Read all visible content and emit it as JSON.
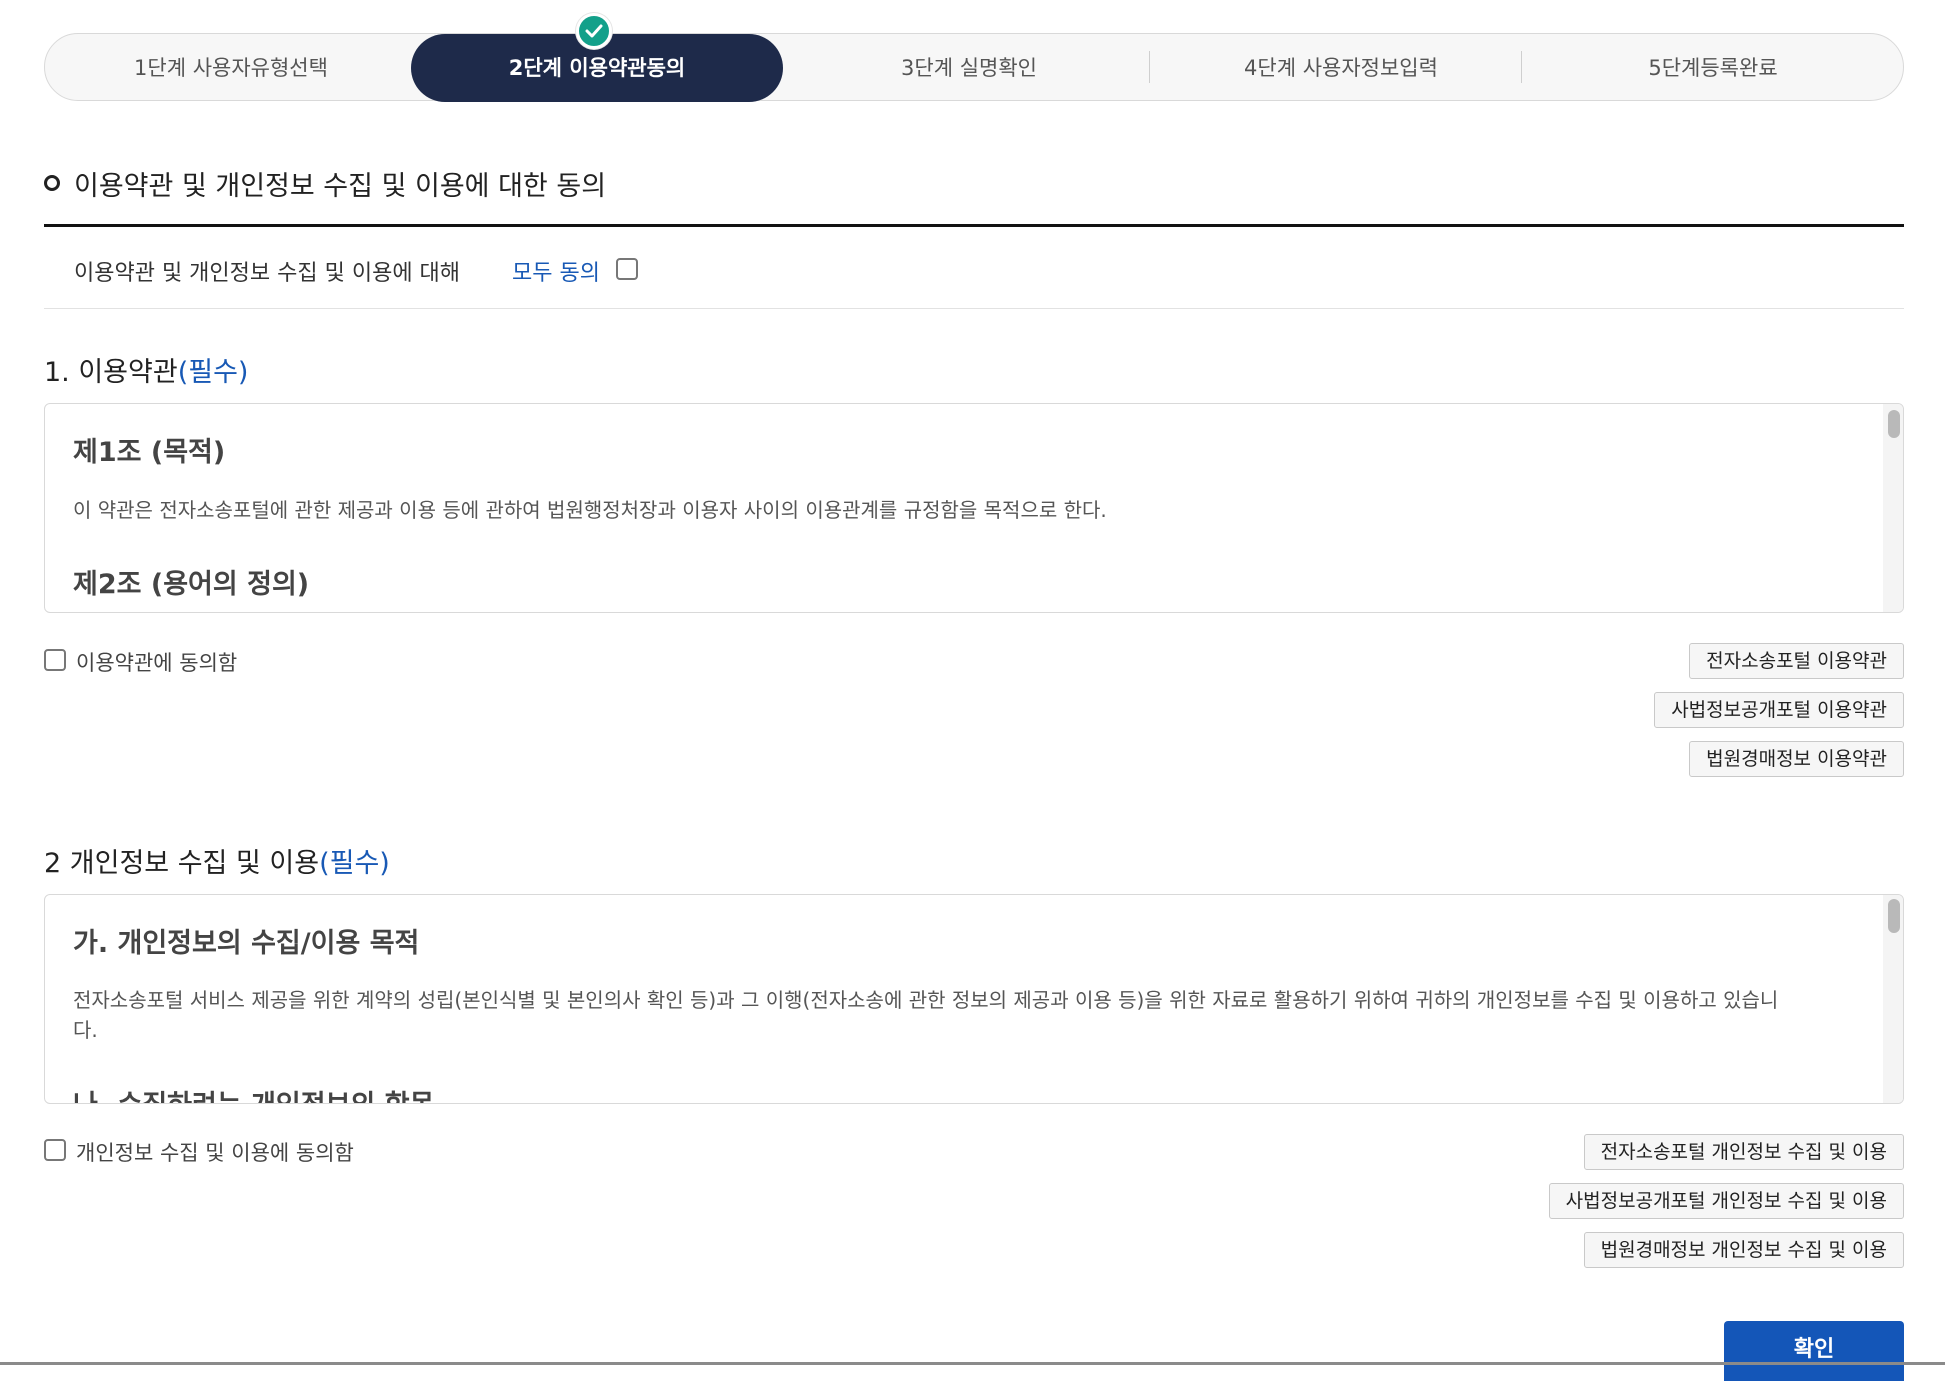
{
  "stepper": {
    "steps": [
      {
        "label": "1단계 사용자유형선택"
      },
      {
        "label": "2단계 이용약관동의"
      },
      {
        "label": "3단계 실명확인"
      },
      {
        "label": "4단계 사용자정보입력"
      },
      {
        "label": "5단계등록완료"
      }
    ],
    "active_index": 1,
    "active_color": "#1e2a4a",
    "check_color": "#13a08a"
  },
  "section": {
    "title": "이용약관 및 개인정보 수집 및 이용에 대한 동의",
    "agree_all_text": "이용약관 및 개인정보 수집 및 이용에 대해",
    "agree_all_link": "모두 동의"
  },
  "terms": {
    "title": "1. 이용약관",
    "required": "(필수)",
    "content": {
      "h1": "제1조 (목적)",
      "p1": "이 약관은 전자소송포털에 관한 제공과 이용 등에 관하여 법원행정처장과 이용자 사이의 이용관계를 규정함을 목적으로 한다.",
      "h2": "제2조 (용어의 정의)"
    },
    "agree_label": "이용약관에 동의함",
    "buttons": [
      "전자소송포털 이용약관",
      "사법정보공개포털 이용약관",
      "법원경매정보 이용약관"
    ]
  },
  "privacy": {
    "title": "2 개인정보 수집 및 이용",
    "required": "(필수)",
    "content": {
      "h1": "가. 개인정보의 수집/이용 목적",
      "p1a": "전자소송포털 서비스 제공을 위한 계약의 성립(본인식별 및 본인의사 확인 등)과 그 이행(전자소송에 관한 정보의 제공과 이용 등)을 위한 자료로 활용하기 위하여 귀하의 개인정보를 수집 및 이용하고 있습니",
      "p1b": "다.",
      "h2": "나. 수집하려는 개인정보의 항목"
    },
    "agree_label": "개인정보 수집 및 이용에 동의함",
    "buttons": [
      "전자소송포털 개인정보 수집 및 이용",
      "사법정보공개포털 개인정보 수집 및 이용",
      "법원경매정보 개인정보 수집 및 이용"
    ]
  },
  "confirm_label": "확인",
  "accent_color": "#1859b5",
  "confirm_color": "#1456b8"
}
